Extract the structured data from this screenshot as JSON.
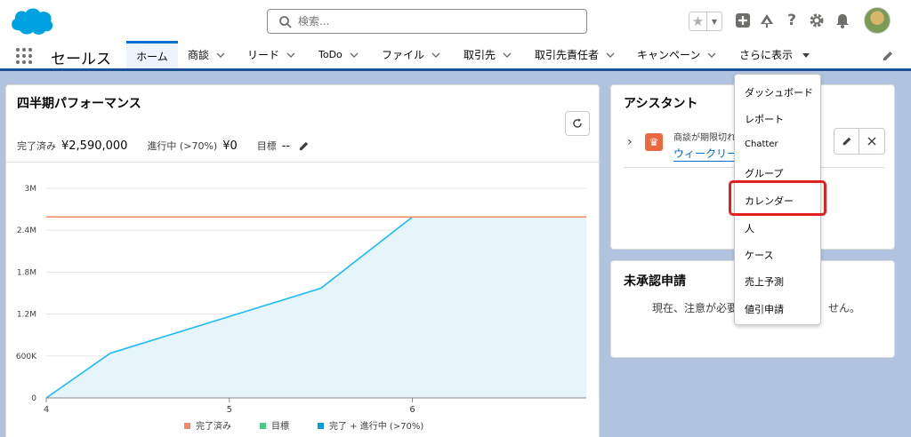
{
  "header": {
    "search_placeholder": "検索...",
    "icons": [
      "favorites-star-icon",
      "global-add-icon",
      "trailhead-icon",
      "help-icon",
      "setup-gear-icon",
      "notification-bell-icon"
    ]
  },
  "nav": {
    "app_name": "セールス",
    "items": [
      {
        "label": "ホーム"
      },
      {
        "label": "商談"
      },
      {
        "label": "リード"
      },
      {
        "label": "ToDo"
      },
      {
        "label": "ファイル"
      },
      {
        "label": "取引先"
      },
      {
        "label": "取引先責任者"
      },
      {
        "label": "キャンペーン"
      },
      {
        "label": "さらに表示"
      }
    ]
  },
  "performance": {
    "title": "四半期パフォーマンス",
    "closed_label": "完了済み",
    "closed_value": "¥2,590,000",
    "open_label": "進行中 (>70%)",
    "open_value": "¥0",
    "goal_label": "目標",
    "goal_value": "--"
  },
  "chart_data": {
    "type": "area",
    "title": "",
    "xlabel": "",
    "ylabel": "",
    "x_ticks": [
      "4",
      "5",
      "6"
    ],
    "y_ticks": [
      "0",
      "600K",
      "1.2M",
      "1.8M",
      "2.4M",
      "3M"
    ],
    "ylim": [
      0,
      3000000
    ],
    "xlim": [
      4,
      6.95
    ],
    "grid": true,
    "legend_position": "bottom",
    "legend": [
      {
        "label": "完了済み",
        "color": "#f88962"
      },
      {
        "label": "目標",
        "color": "#4bca81"
      },
      {
        "label": "完了 + 進行中 (>70%)",
        "color": "#00a1e0"
      }
    ],
    "series": [
      {
        "name": "完了済み",
        "color": "#f88962",
        "points": [
          [
            4,
            2590000
          ],
          [
            6.95,
            2590000
          ]
        ]
      },
      {
        "name": "完了 + 進行中 (>70%)",
        "color": "#1ab9ff",
        "fill": "#e6f5fc",
        "points": [
          [
            4,
            0
          ],
          [
            4.35,
            640000
          ],
          [
            5.5,
            1570000
          ],
          [
            6,
            2590000
          ],
          [
            6.95,
            2590000
          ]
        ]
      }
    ]
  },
  "assistant": {
    "title": "アシスタント",
    "item_text": "商談が期限切れ",
    "item_link": "ウィークリー"
  },
  "pending": {
    "title": "未承認申請",
    "message_left": "現在、注意が必要",
    "message_right": "せん。"
  },
  "more_menu": {
    "items": [
      "ダッシュボード",
      "レポート",
      "Chatter",
      "グループ",
      "カレンダー",
      "人",
      "ケース",
      "売上予測",
      "値引申請"
    ],
    "highlighted": "カレンダー",
    "highlight_color": "#e0201f"
  }
}
